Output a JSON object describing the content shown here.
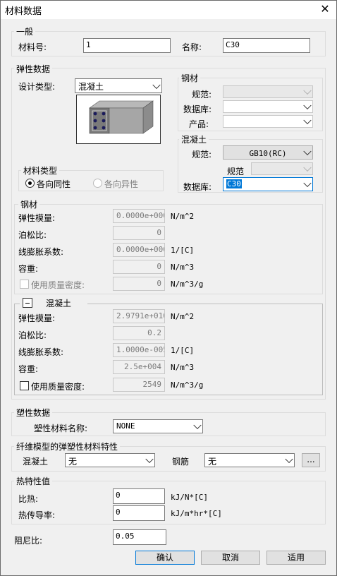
{
  "window": {
    "title": "材料数据",
    "close": "✕"
  },
  "general": {
    "legend": "一般",
    "material_no_label": "材料号:",
    "material_no_value": "1",
    "name_label": "名称:",
    "name_value": "C30"
  },
  "elastic": {
    "legend": "弹性数据",
    "design_type_label": "设计类型:",
    "design_type_value": "混凝土",
    "steel_group": {
      "legend": "钢材",
      "spec_label": "规范:",
      "db_label": "数据库:",
      "product_label": "产品:"
    },
    "concrete_group": {
      "legend": "混凝土",
      "spec_label": "规范:",
      "spec_value": "GB10(RC)",
      "sub_spec_label": "规范",
      "db_label": "数据库:",
      "db_value": "C30"
    },
    "material_type": {
      "legend": "材料类型",
      "isotropic": "各向同性",
      "anisotropic": "各向异性"
    },
    "steel_props": {
      "legend": "钢材",
      "rows": [
        {
          "label": "弹性模量:",
          "value": "0.0000e+000",
          "unit": "N/m^2"
        },
        {
          "label": "泊松比:",
          "value": "0",
          "unit": ""
        },
        {
          "label": "线膨胀系数:",
          "value": "0.0000e+000",
          "unit": "1/[C]"
        },
        {
          "label": "容重:",
          "value": "0",
          "unit": "N/m^3"
        },
        {
          "label": "使用质量密度:",
          "value": "0",
          "unit": "N/m^3/g"
        }
      ]
    },
    "concrete_props": {
      "legend": "混凝土",
      "rows": [
        {
          "label": "弹性模量:",
          "value": "2.9791e+010",
          "unit": "N/m^2"
        },
        {
          "label": "泊松比:",
          "value": "0.2",
          "unit": ""
        },
        {
          "label": "线膨胀系数:",
          "value": "1.0000e-005",
          "unit": "1/[C]"
        },
        {
          "label": "容重:",
          "value": "2.5e+004",
          "unit": "N/m^3"
        },
        {
          "label": "使用质量密度:",
          "value": "2549",
          "unit": "N/m^3/g"
        }
      ]
    }
  },
  "plastic": {
    "legend": "塑性数据",
    "name_label": "塑性材料名称:",
    "name_value": "NONE"
  },
  "fiber": {
    "legend": "纤维模型的弹塑性材料特性",
    "concrete_label": "混凝土",
    "concrete_value": "无",
    "rebar_label": "钢筋",
    "rebar_value": "无",
    "more_button": "..."
  },
  "thermal": {
    "legend": "热特性值",
    "specific_heat_label": "比热:",
    "specific_heat_value": "0",
    "specific_heat_unit": "kJ/N*[C]",
    "conductivity_label": "热传导率:",
    "conductivity_value": "0",
    "conductivity_unit": "kJ/m*hr*[C]"
  },
  "damping": {
    "label": "阻尼比:",
    "value": "0.05"
  },
  "buttons": {
    "ok": "确认",
    "cancel": "取消",
    "apply": "适用"
  }
}
